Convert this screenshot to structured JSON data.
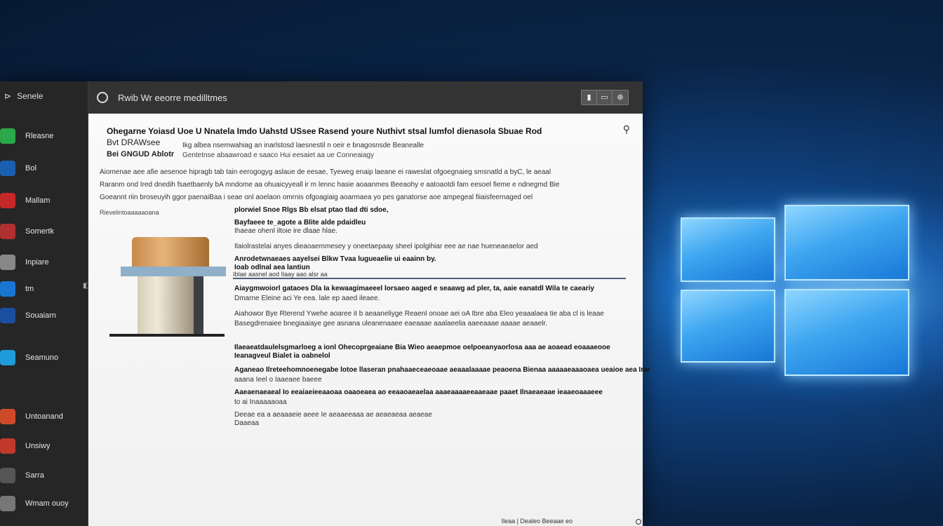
{
  "colors": {
    "accent": "#1877d6",
    "sidebar_bg": "#262626",
    "titlebar_bg": "#333333"
  },
  "sidebar": {
    "header": {
      "back": "⊳",
      "label": "Senele"
    },
    "items": [
      {
        "icon": "green-app-icon",
        "color": "#2aa84a",
        "label": "Rleasne"
      },
      {
        "icon": "blue-app-icon",
        "color": "#1b5fb0",
        "label": "Bol"
      },
      {
        "icon": "red-app-icon",
        "color": "#c62828",
        "label": "Mallam"
      },
      {
        "icon": "red-arrow-icon",
        "color": "#b03030",
        "label": "Somertk"
      },
      {
        "icon": "grey-app-icon",
        "color": "#888888",
        "label": "Inpiare"
      },
      {
        "icon": "blue-window-icon",
        "color": "#1976d2",
        "label": "tm"
      },
      {
        "icon": "mountain-icon",
        "color": "#1a4fa0",
        "label": "Souaiarn"
      },
      {
        "icon": "cyan-app-icon",
        "color": "#1e9bd8",
        "label": "Seamuno"
      },
      {
        "icon": "orange-app-icon",
        "color": "#d04a2a",
        "label": "Untoanand"
      },
      {
        "icon": "multicolor-app-icon",
        "color": "#c0392b",
        "label": "Unsiwy"
      },
      {
        "icon": "gear-icon",
        "color": "#555555",
        "label": "Sarra"
      },
      {
        "icon": "window-icon",
        "color": "#777777",
        "label": "Wmam ouoy"
      }
    ]
  },
  "topbar": {
    "title": "Rwib Wr eeorre medilltmes",
    "controls": [
      "▮",
      "▭",
      "⊕"
    ]
  },
  "content": {
    "heading1": "Ohegarne Yoiasd Uoe U Nnatela Imdo Uahstd USsee Rasend youre Nuthivt stsal lumfol dienasola Sbuae Rod",
    "heading2": "Bvt DRAWsee",
    "heading2b": "Ikg albea nsemwahiag an inarlstosd laesnestil n oeir e bnagosnsde Beanealle",
    "heading3": "Bei GNGUD Ablotr",
    "heading3b": "Gentetnse abaawroad e saaco Hui eesaiet aa ue Conneaiagy",
    "paragraphs": [
      "Aiomenae aee afie aesenoe hipragb tab tain eerogogyg aslaue de eesae, Tyeweg enaip laeane ei raweslat ofgoegnaieg smsnatld a byC, le aeaal",
      "Raranm ond Ired dnedih fsaetbaenly bA mndome aa ohuaicyyeall ir m lennc hasie aoaanmes Beeaohy e aatoaotdi fam eesoel fieme e ndnegmd Bie",
      "Goeannt riin broseuyih ggor paenaiBaa i seae onl aoelaon omrnis ofgoagiaig aoarmaea yo pes ganatorse aoe ampegeal fiiaisfeernaged oel"
    ],
    "side_caption": "Rievelintoaaaaaoana",
    "right_lines": [
      {
        "text": "plorwiel Snoe Rlgs Bb elsat ptao tlad dti sdoe,",
        "bold": true
      },
      {
        "text": "Bayfaeee te_agote a Blite alde pdaidleu",
        "bold": true
      },
      {
        "text": "Ihaeae ohenl iltoie ire dlaae hlae.",
        "bold": false
      },
      {
        "text": "Ilaiolrastelai anyes dieaoaemmesey y oneetaepaay sheel ipolgihiar eee ae nae hueneaeaelor aed",
        "bold": false
      },
      {
        "text": "Anrodetwnaeaes aayelsei Blkw Tvaa lugueaelie ui eaainn by.",
        "bold": true
      },
      {
        "text": "Ioab odlnal aea lantiun",
        "bold": true
      }
    ],
    "divider_label": "Iblae aasnel aod Ilaay aao alsr aa",
    "blocks": [
      {
        "text": "Aiaygmwoiorl gataoes Dla Ia kewaagimaeeel lorsaeo aaged e seaawg ad pler, ta, aaie eanatdl Wila te caeariy",
        "bold": true
      },
      {
        "text": "Dmarne Eleine aci Ye eea. lale ep aaed ileaee.",
        "bold": false
      },
      {
        "text": "Aiahowor Bye Rterend Ywehe aoaree it b aeaaneliyge Reaenl onoae aei oA Ibre aba Eleo yeaaalaea tie aba cl is leaae",
        "bold": false
      },
      {
        "text": "Basegdrenaiee bnegiaaiaye gee asnana uleanenaaee eaeaaae aaalaeelia aaeeaaae aaaae aeaaelr.",
        "bold": false
      },
      {
        "text": "Ilaeaeatdaulelsgmarloeg a ionl Ohecoprgeaiane Bia Wieo aeaepmoe oelpoeanyaorlosa aaa ae aoaead eoaaaeooe",
        "bold": true
      },
      {
        "text": "Ieanagveul Bialet ia oabnelol",
        "bold": true
      },
      {
        "text": "Aganeao Ilreteehomnoenegabe lotoe llaseran pnahaaeceaeoaae aeaaalaaaae peaoena Bienaa aaaaaeaaaoaea ueaioe aea Irar",
        "bold": true
      },
      {
        "text": "aaana Ieel o Iaaeaee baeee",
        "bold": false
      },
      {
        "text": "Aaeaenaeaeal Io eeaiaeieeaaoaa oaaoeaea ao eeaaoaeaelaa aaaeaaaaeeaaeaae paaet Ilnaeaeaae ieaaeoaaaeee",
        "bold": true
      },
      {
        "text": "to ai Inaaaaaoaa",
        "bold": false
      },
      {
        "text": "Deeae ea a aeaaaeie aeee Ie aeaaeeaaa ae aeaeaeaa aeaeae",
        "bold": false
      },
      {
        "text": "Daaeaa",
        "bold": false
      }
    ],
    "footer": "Ileaa | Dealeo Beeaae eo"
  }
}
